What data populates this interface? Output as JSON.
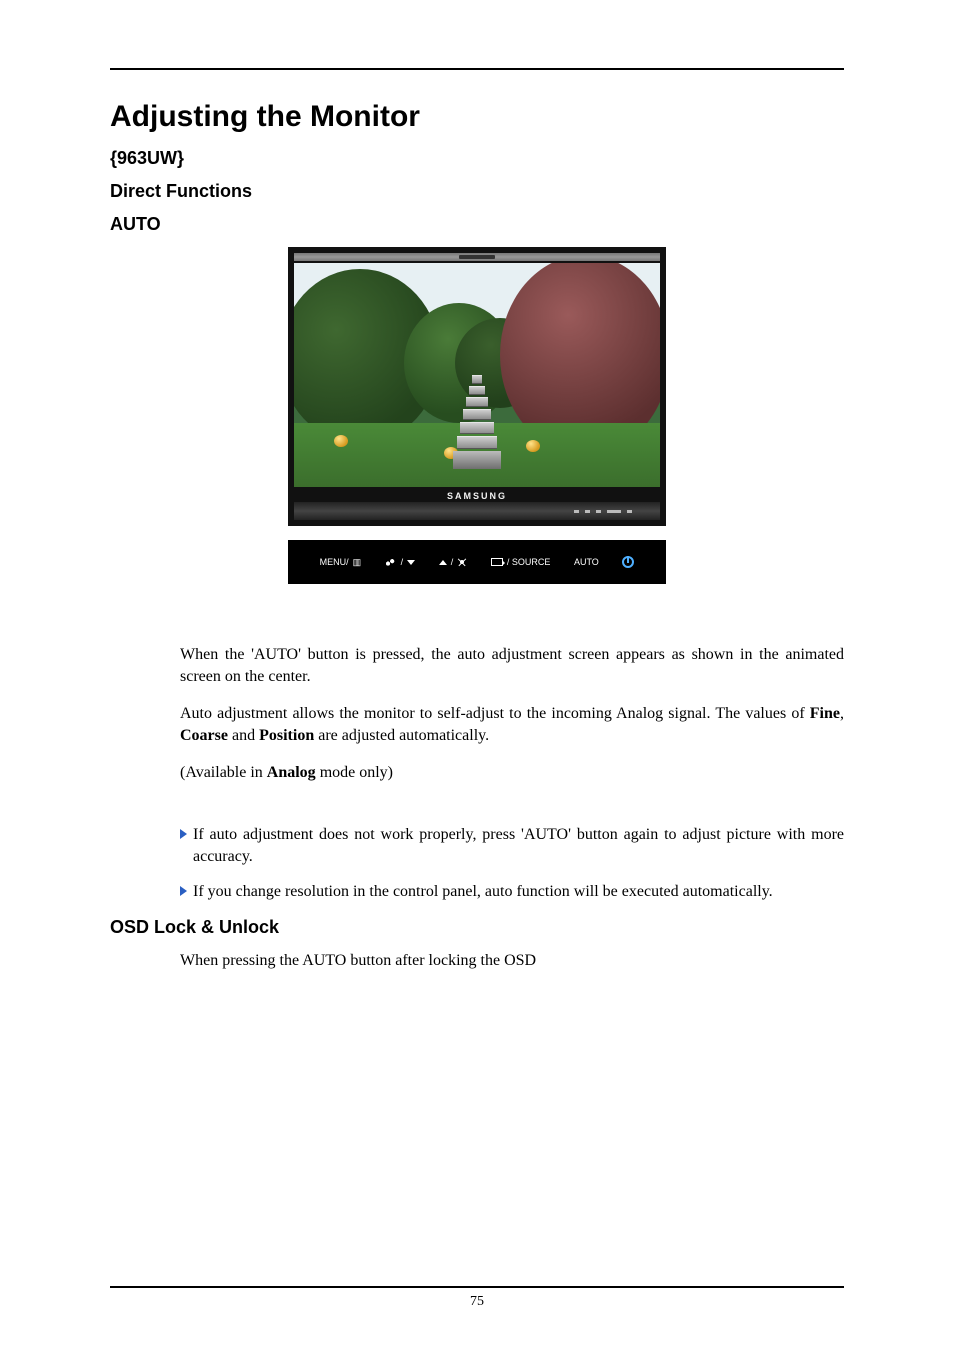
{
  "page_title": "Adjusting the Monitor",
  "model": "{963UW}",
  "section_direct_functions": "Direct Functions",
  "section_auto": "AUTO",
  "monitor_brand": "SAMSUNG",
  "button_bar": {
    "menu": "MENU/",
    "menu_glyph": "▥",
    "down_sep": "/",
    "up_sep": " / ",
    "source_label": "/ SOURCE",
    "auto": "AUTO"
  },
  "paragraphs": {
    "p1": "When the 'AUTO' button is pressed, the auto adjustment screen appears as shown in the animated screen on the center.",
    "p2_a": "Auto adjustment allows the monitor to self-adjust to the incoming Analog signal. The values of ",
    "p2_fine": "Fine",
    "p2_sep1": ", ",
    "p2_coarse": "Coarse",
    "p2_sep2": " and ",
    "p2_position": "Position",
    "p2_b": " are adjusted automatically.",
    "p3_a": "(Available in ",
    "p3_analog": "Analog",
    "p3_b": " mode only)"
  },
  "notes": {
    "n1": "If auto adjustment does not work properly, press 'AUTO' button again to adjust picture with more accuracy.",
    "n2": "If you change resolution in the control panel, auto function will be executed automatically."
  },
  "section_osd": "OSD Lock & Unlock",
  "osd_intro": "When pressing the AUTO button after locking the OSD",
  "page_number": "75"
}
